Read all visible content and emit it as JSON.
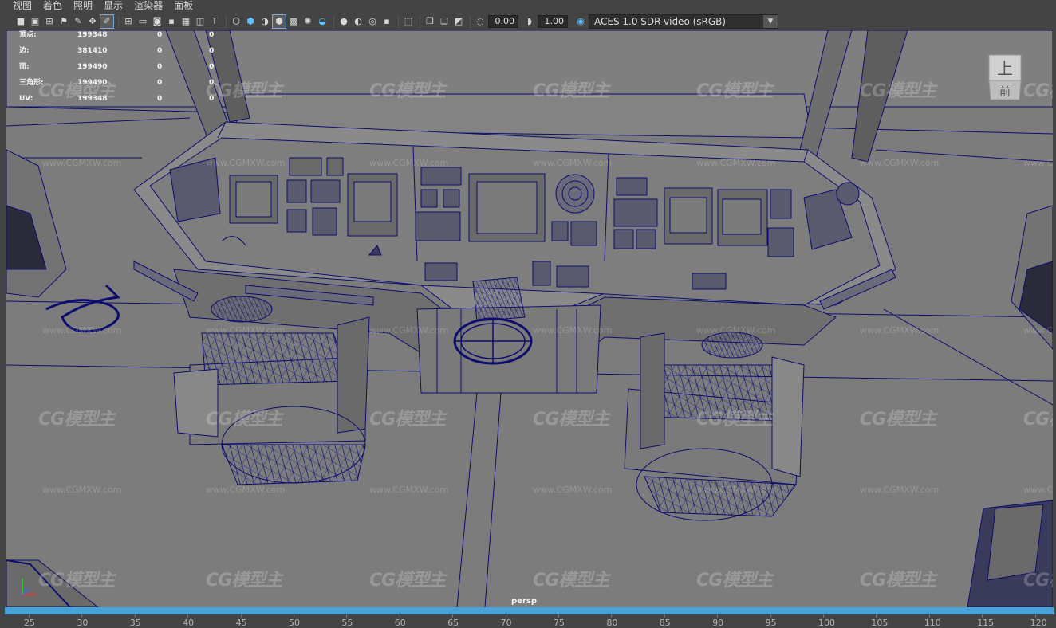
{
  "menu": [
    "视图",
    "着色",
    "照明",
    "显示",
    "渲染器",
    "面板"
  ],
  "toolbar": {
    "exposure": "0.00",
    "gamma": "1.00",
    "color_space": "ACES 1.0 SDR-video (sRGB)"
  },
  "hud": {
    "rows": [
      {
        "label": "顶点:",
        "v1": "199348",
        "v2": "0",
        "v3": "0"
      },
      {
        "label": "边:",
        "v1": "381410",
        "v2": "0",
        "v3": "0"
      },
      {
        "label": "面:",
        "v1": "199490",
        "v2": "0",
        "v3": "0"
      },
      {
        "label": "三角形:",
        "v1": "199490",
        "v2": "0",
        "v3": "0"
      },
      {
        "label": "UV:",
        "v1": "199348",
        "v2": "0",
        "v3": "0"
      }
    ]
  },
  "viewcube": {
    "top": "上",
    "front": "前"
  },
  "camera": "persp",
  "watermark": {
    "logo": "CG模型主",
    "url": "www.CGMXW.com"
  },
  "timeline": {
    "ticks": [
      "25",
      "30",
      "35",
      "40",
      "45",
      "50",
      "55",
      "60",
      "65",
      "70",
      "75",
      "80",
      "85",
      "90",
      "95",
      "100",
      "105",
      "110",
      "115",
      "120"
    ]
  },
  "colors": {
    "wireframe": "#0d0d6e",
    "viewport_bg": "#7c7c7c",
    "timebar": "#4aa3d8"
  }
}
